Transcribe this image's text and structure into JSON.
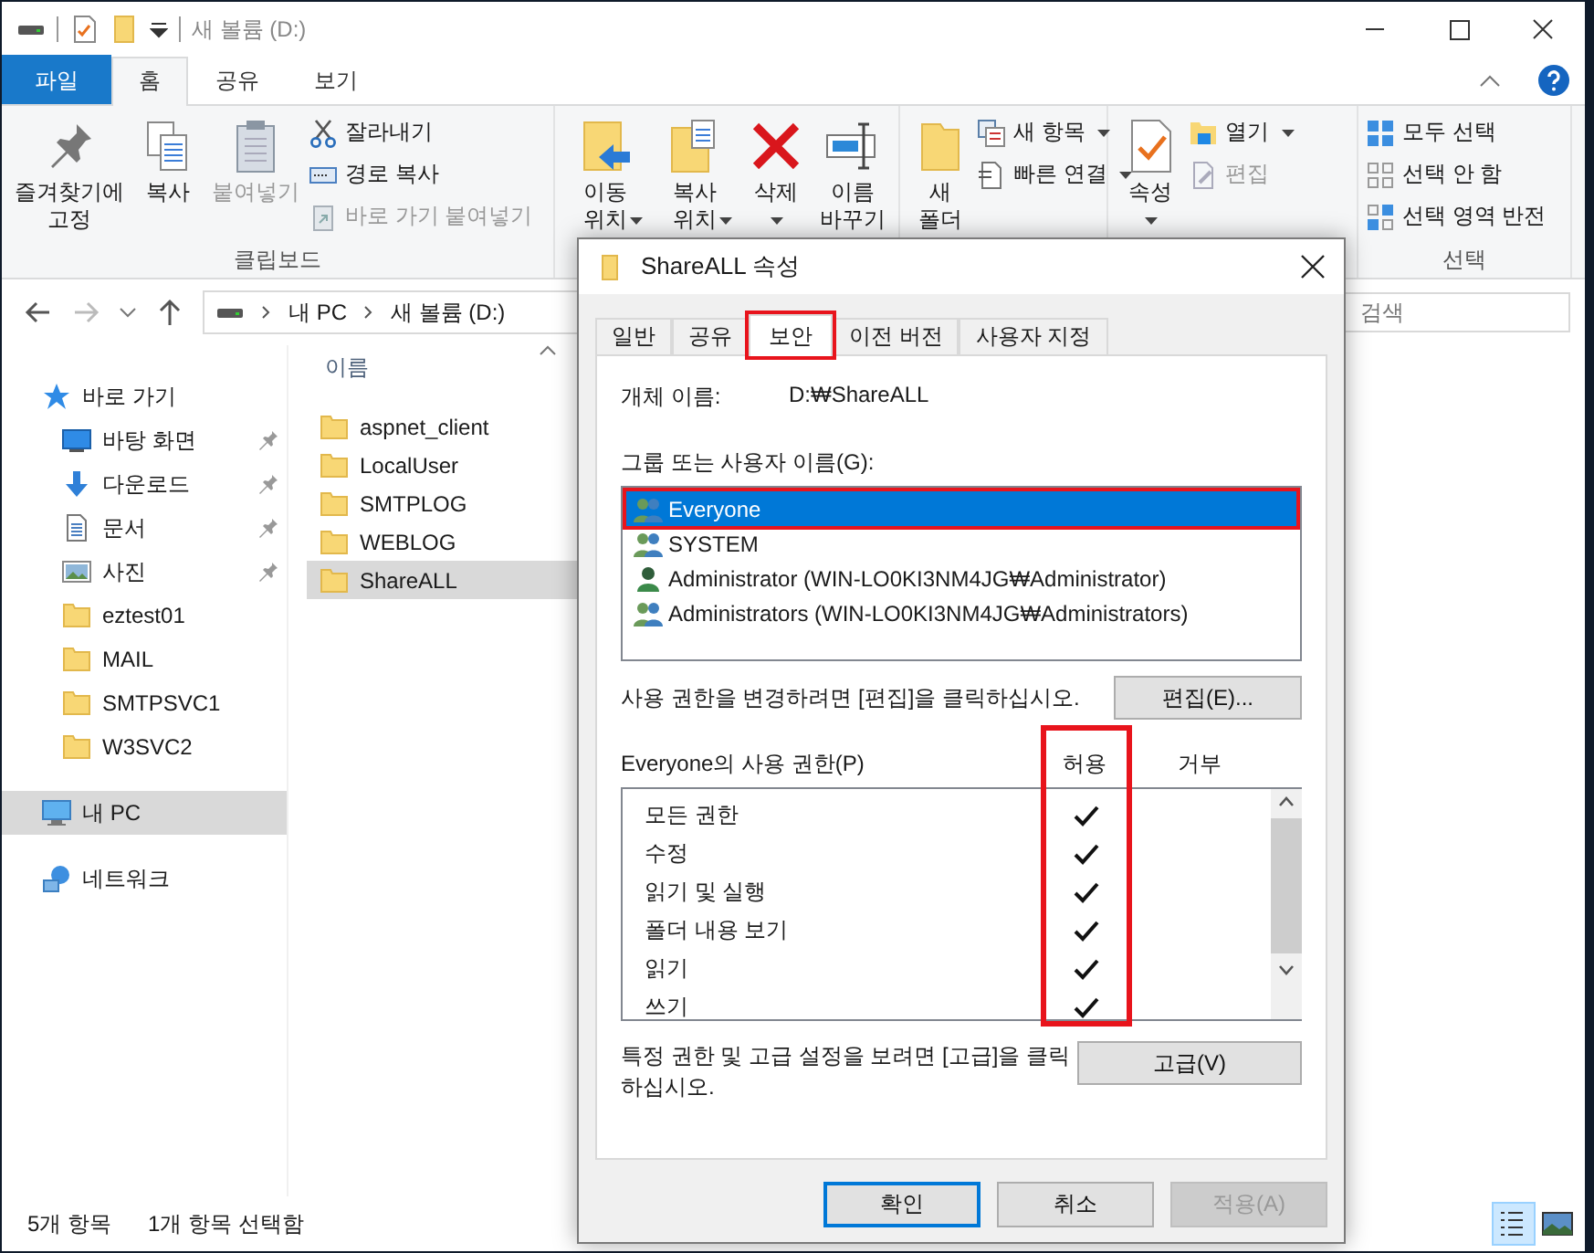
{
  "window": {
    "title": "새 볼륨 (D:)"
  },
  "ribbon": {
    "tabs": [
      {
        "label": "파일",
        "kind": "file",
        "selected": false
      },
      {
        "label": "홈",
        "kind": "tab",
        "selected": true
      },
      {
        "label": "공유",
        "kind": "tab",
        "selected": false
      },
      {
        "label": "보기",
        "kind": "tab",
        "selected": false
      }
    ],
    "groups": [
      {
        "label": "클립보드",
        "large": [
          {
            "label": "즐겨찾기에\n고정",
            "dropdown": false,
            "disabled": false
          },
          {
            "label": "복사",
            "dropdown": false,
            "disabled": false
          },
          {
            "label": "붙여넣기",
            "dropdown": false,
            "disabled": true
          }
        ],
        "small": [
          {
            "label": "잘라내기",
            "dropdown": false,
            "disabled": false
          },
          {
            "label": "경로 복사",
            "dropdown": false,
            "disabled": false
          },
          {
            "label": "바로 가기 붙여넣기",
            "dropdown": false,
            "disabled": true
          }
        ]
      },
      {
        "large": [
          {
            "label": "이동\n위치",
            "dropdown": true,
            "disabled": false
          },
          {
            "label": "복사\n위치",
            "dropdown": true,
            "disabled": false
          },
          {
            "label": "삭제",
            "dropdown": true,
            "disabled": false
          },
          {
            "label": "이름\n바꾸기",
            "dropdown": false,
            "disabled": false
          }
        ]
      },
      {
        "large": [
          {
            "label": "새\n폴더",
            "dropdown": false,
            "disabled": false
          }
        ],
        "small": [
          {
            "label": "새 항목",
            "dropdown": true,
            "disabled": false
          },
          {
            "label": "빠른 연결",
            "dropdown": true,
            "disabled": false
          }
        ]
      },
      {
        "large": [
          {
            "label": "속성",
            "dropdown": true,
            "disabled": false
          }
        ],
        "small": [
          {
            "label": "열기",
            "dropdown": true,
            "disabled": false
          },
          {
            "label": "편집",
            "dropdown": false,
            "disabled": true
          }
        ]
      },
      {
        "label": "선택",
        "small": [
          {
            "label": "모두 선택",
            "dropdown": false,
            "disabled": false
          },
          {
            "label": "선택 안 함",
            "dropdown": false,
            "disabled": false
          },
          {
            "label": "선택 영역 반전",
            "dropdown": false,
            "disabled": false
          }
        ]
      }
    ]
  },
  "history": {
    "back_disabled": false,
    "forward_disabled": true
  },
  "address": {
    "segments": [
      "내 PC",
      "새 볼륨 (D:)"
    ]
  },
  "search": {
    "placeholder": "검색"
  },
  "nav": {
    "items": [
      {
        "label": "바로 가기",
        "kind": "quick-access",
        "pinned": false,
        "selected": false,
        "children": [
          {
            "label": "바탕 화면",
            "kind": "desktop",
            "pinned": true,
            "selected": false
          },
          {
            "label": "다운로드",
            "kind": "downloads",
            "pinned": true,
            "selected": false
          },
          {
            "label": "문서",
            "kind": "documents",
            "pinned": true,
            "selected": false
          },
          {
            "label": "사진",
            "kind": "pictures",
            "pinned": true,
            "selected": false
          },
          {
            "label": "eztest01",
            "kind": "folder",
            "pinned": false,
            "selected": false
          },
          {
            "label": "MAIL",
            "kind": "folder",
            "pinned": false,
            "selected": false
          },
          {
            "label": "SMTPSVC1",
            "kind": "folder",
            "pinned": false,
            "selected": false
          },
          {
            "label": "W3SVC2",
            "kind": "folder",
            "pinned": false,
            "selected": false
          }
        ]
      },
      {
        "label": "내 PC",
        "kind": "pc",
        "pinned": false,
        "selected": true
      },
      {
        "label": "네트워크",
        "kind": "network",
        "pinned": false,
        "selected": false
      }
    ]
  },
  "files": {
    "column": "이름",
    "items": [
      {
        "name": "aspnet_client",
        "selected": false
      },
      {
        "name": "LocalUser",
        "selected": false
      },
      {
        "name": "SMTPLOG",
        "selected": false
      },
      {
        "name": "WEBLOG",
        "selected": false
      },
      {
        "name": "ShareALL",
        "selected": true
      }
    ]
  },
  "status_bar": {
    "count": "5개 항목",
    "selection": "1개 항목 선택함",
    "views": [
      {
        "kind": "details",
        "selected": true
      },
      {
        "kind": "thumbnails",
        "selected": false
      }
    ]
  },
  "dialog": {
    "title": "ShareALL 속성",
    "tabs": [
      {
        "label": "일반",
        "selected": false,
        "highlighted": false
      },
      {
        "label": "공유",
        "selected": false,
        "highlighted": false
      },
      {
        "label": "보안",
        "selected": true,
        "highlighted": true
      },
      {
        "label": "이전 버전",
        "selected": false,
        "highlighted": false
      },
      {
        "label": "사용자 지정",
        "selected": false,
        "highlighted": false
      }
    ],
    "object_label": "개체 이름:",
    "object_value": "D:₩ShareALL",
    "principals_label": "그룹 또는 사용자 이름(G):",
    "principals": [
      {
        "name": "Everyone",
        "kind": "group",
        "selected": true,
        "highlighted": true
      },
      {
        "name": "SYSTEM",
        "kind": "group",
        "selected": false,
        "highlighted": false
      },
      {
        "name": "Administrator (WIN-LO0KI3NM4JG₩Administrator)",
        "kind": "user",
        "selected": false,
        "highlighted": false
      },
      {
        "name": "Administrators (WIN-LO0KI3NM4JG₩Administrators)",
        "kind": "group",
        "selected": false,
        "highlighted": false
      }
    ],
    "edit_hint": "사용 권한을 변경하려면 [편집]을 클릭하십시오.",
    "edit_button": "편집(E)...",
    "permissions": {
      "title": "Everyone의 사용 권한(P)",
      "allow_label": "허용",
      "deny_label": "거부",
      "allow_highlighted": true,
      "rows": [
        {
          "name": "모든 권한",
          "allow": true,
          "deny": false
        },
        {
          "name": "수정",
          "allow": true,
          "deny": false
        },
        {
          "name": "읽기 및 실행",
          "allow": true,
          "deny": false
        },
        {
          "name": "폴더 내용 보기",
          "allow": true,
          "deny": false
        },
        {
          "name": "읽기",
          "allow": true,
          "deny": false
        },
        {
          "name": "쓰기",
          "allow": true,
          "deny": false
        }
      ]
    },
    "advanced_hint": "특정 권한 및 고급 설정을 보려면 [고급]을 클릭하십시오.",
    "advanced_button": "고급(V)",
    "buttons": [
      {
        "label": "확인",
        "kind": "default",
        "disabled": false
      },
      {
        "label": "취소",
        "kind": "normal",
        "disabled": false
      },
      {
        "label": "적용(A)",
        "kind": "normal",
        "disabled": true
      }
    ]
  }
}
